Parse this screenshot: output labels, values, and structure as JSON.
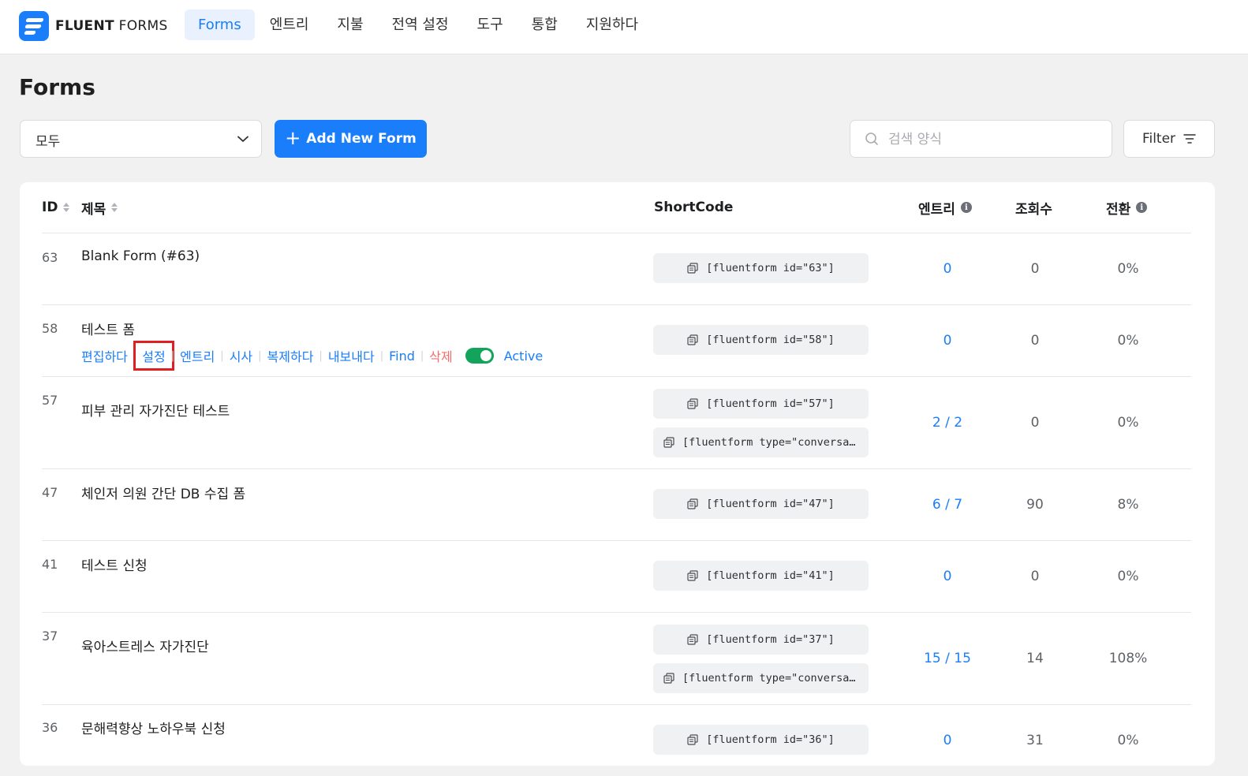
{
  "brand": {
    "name_bold": "FLUENT",
    "name_light": "FORMS"
  },
  "nav": [
    {
      "label": "Forms",
      "active": true
    },
    {
      "label": "엔트리"
    },
    {
      "label": "지불"
    },
    {
      "label": "전역 설정"
    },
    {
      "label": "도구"
    },
    {
      "label": "통합"
    },
    {
      "label": "지원하다"
    }
  ],
  "page": {
    "title": "Forms"
  },
  "toolbar": {
    "filter_select_value": "모두",
    "add_button_label": "Add New Form",
    "search_placeholder": "검색 양식",
    "filter_button_label": "Filter"
  },
  "table": {
    "columns": {
      "id": "ID",
      "title": "제목",
      "shortcode": "ShortCode",
      "entries": "엔트리",
      "views": "조회수",
      "conversion": "전환"
    },
    "rows": [
      {
        "id": "63",
        "title": "Blank Form (#63)",
        "shortcodes": [
          "[fluentform id=\"63\"]"
        ],
        "entries": "0",
        "views": "0",
        "conversion": "0%"
      },
      {
        "id": "58",
        "title": "테스트 폼",
        "shortcodes": [
          "[fluentform id=\"58\"]"
        ],
        "entries": "0",
        "views": "0",
        "conversion": "0%"
      },
      {
        "id": "57",
        "title": "피부 관리 자가진단 테스트",
        "shortcodes": [
          "[fluentform id=\"57\"]",
          "[fluentform type=\"conversa…"
        ],
        "entries": "2 / 2",
        "views": "0",
        "conversion": "0%"
      },
      {
        "id": "47",
        "title": "체인저 의원 간단 DB 수집 폼",
        "shortcodes": [
          "[fluentform id=\"47\"]"
        ],
        "entries": "6 / 7",
        "views": "90",
        "conversion": "8%"
      },
      {
        "id": "41",
        "title": "테스트 신청",
        "shortcodes": [
          "[fluentform id=\"41\"]"
        ],
        "entries": "0",
        "views": "0",
        "conversion": "0%"
      },
      {
        "id": "37",
        "title": "육아스트레스 자가진단",
        "shortcodes": [
          "[fluentform id=\"37\"]",
          "[fluentform type=\"conversa…"
        ],
        "entries": "15 / 15",
        "views": "14",
        "conversion": "108%"
      },
      {
        "id": "36",
        "title": "문해력향상 노하우북 신청",
        "shortcodes": [
          "[fluentform id=\"36\"]"
        ],
        "entries": "0",
        "views": "31",
        "conversion": "0%"
      }
    ],
    "row_actions": {
      "edit": "편집하다",
      "settings": "설정",
      "entries": "엔트리",
      "preview": "시사",
      "duplicate": "복제하다",
      "export": "내보내다",
      "find": "Find",
      "delete": "삭제",
      "status": "Active"
    }
  },
  "colors": {
    "accent": "#1a7efb",
    "toggle_on": "#13a45b",
    "delete": "#f56c6c",
    "highlight_box": "#e02020"
  }
}
